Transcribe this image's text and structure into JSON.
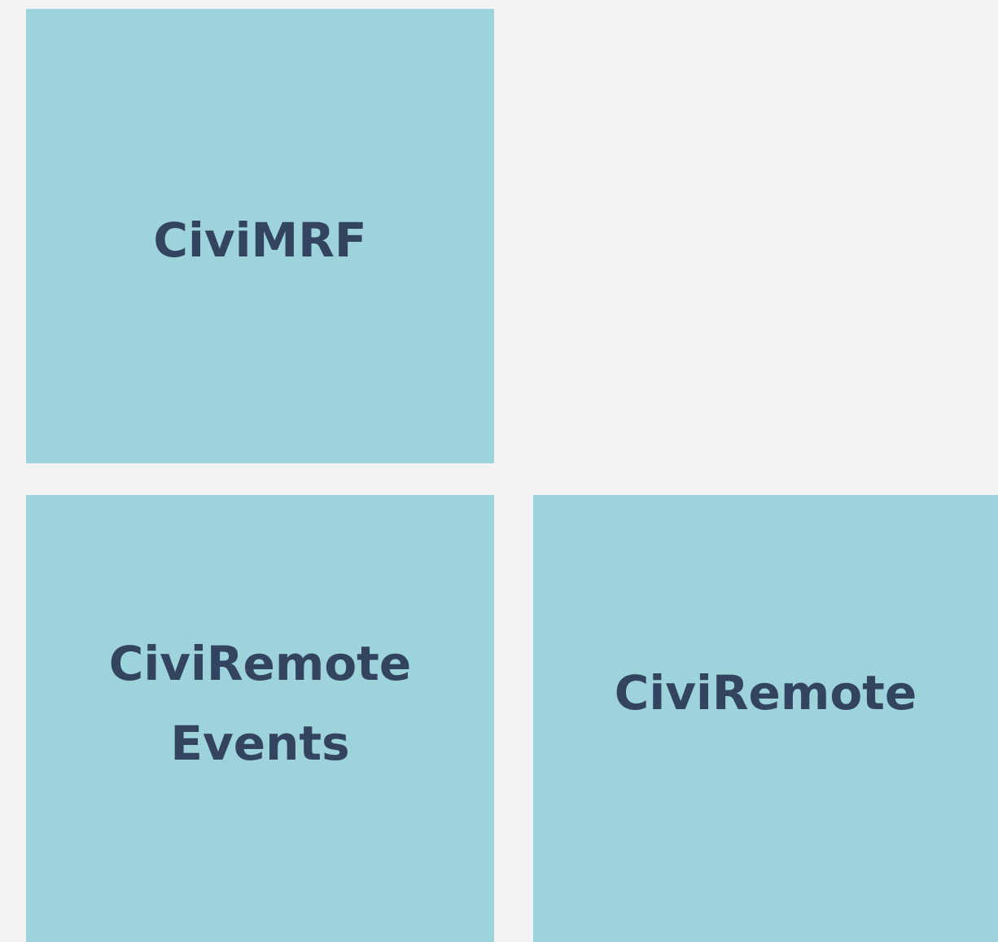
{
  "tiles": [
    {
      "label_lines": [
        "CiviMRF"
      ]
    },
    {
      "label_lines": [
        "CiviRemote",
        "Events"
      ]
    },
    {
      "label_lines": [
        "CiviRemote"
      ]
    }
  ],
  "colors": {
    "background": "#f2f3f2",
    "tile": "#9ed3dc",
    "text": "#33445f"
  }
}
